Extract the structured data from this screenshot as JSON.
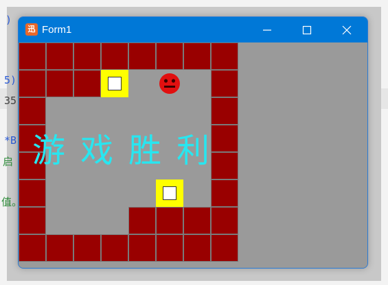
{
  "window": {
    "title": "Form1",
    "icon_glyph": "迅",
    "minimize_icon": "minimize-icon",
    "maximize_icon": "maximize-icon",
    "close_icon": "close-icon"
  },
  "background_editor": {
    "fragments": [
      {
        "text": ")",
        "color": "#2b5bd7"
      },
      {
        "text": "5)",
        "color": "#2b5bd7"
      },
      {
        "text": "35",
        "color": "#444444"
      },
      {
        "text": "*B",
        "color": "#2b5bd7"
      },
      {
        "text": "启",
        "color": "#2e8b3a"
      },
      {
        "text": "值。",
        "color": "#2e8b3a"
      }
    ]
  },
  "game": {
    "message": "游戏胜利",
    "colors": {
      "wall": "#990000",
      "floor": "#9a9a9a",
      "target": "#ffff00",
      "box_face": "#ffffff",
      "player": "#e11010",
      "message": "#28e6f0"
    },
    "grid_cols": 8,
    "grid_rows": 8,
    "map": [
      "WWWWWWWW",
      "WWWT.P.W",
      "W......W",
      "W......W",
      "W......W",
      "W....T.W",
      "W...WWWW",
      "WWWWWWWW"
    ]
  }
}
